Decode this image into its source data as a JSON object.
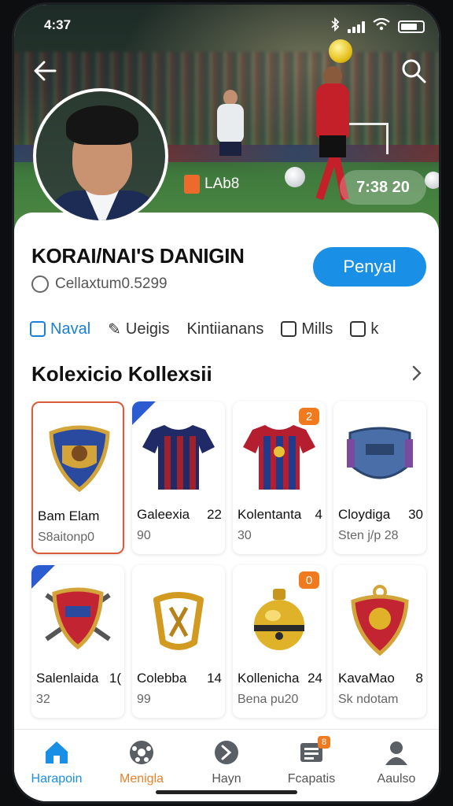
{
  "status_bar": {
    "time": "4:37"
  },
  "header": {
    "chip_left": "LAb8",
    "chip_right": "7:38 20"
  },
  "profile": {
    "name": "KORAI/NAI'S DANIGIN",
    "subtitle": "Cellaxtum0.5299",
    "follow_label": "Penyal"
  },
  "tabs": [
    {
      "label": "Naval",
      "active": true
    },
    {
      "label": "Ueigis"
    },
    {
      "label": "Kintiianans"
    },
    {
      "label": "Mills"
    },
    {
      "label": "k"
    }
  ],
  "collection": {
    "title": "Kolexicio Kollexsii",
    "items": [
      {
        "title": "Bam Elam",
        "count": "",
        "meta": "S8aitonp0",
        "art": "shield-icon",
        "selected": true
      },
      {
        "title": "Galeexia",
        "count": "22",
        "meta": "90",
        "art": "jersey-icon",
        "ribbon": "purple"
      },
      {
        "title": "Kolentanta",
        "count": "4",
        "meta": "30",
        "art": "jersey-icon",
        "badge": "2"
      },
      {
        "title": "Cloydiga",
        "count": "30",
        "meta": "Sten j/p 28",
        "art": "banner-icon"
      },
      {
        "title": "Salenlaida",
        "count": "1(",
        "meta": "32",
        "art": "shield-icon",
        "ribbon": "orange"
      },
      {
        "title": "Colebba",
        "count": "14",
        "meta": "99",
        "art": "emblem-icon"
      },
      {
        "title": "Kollenicha",
        "count": "24",
        "meta": "Bena pu20",
        "art": "trophy-icon",
        "badge": "0"
      },
      {
        "title": "KavaMao",
        "count": "8",
        "meta": "Sk ndotam",
        "art": "crest-icon"
      }
    ]
  },
  "nav": [
    {
      "label": "Harapoin",
      "icon": "home-icon",
      "active": true
    },
    {
      "label": "Menigla",
      "icon": "ball-icon",
      "warm": true
    },
    {
      "label": "Hayn",
      "icon": "play-icon"
    },
    {
      "label": "Fcapatis",
      "icon": "list-icon",
      "badge": "8"
    },
    {
      "label": "Aaulso",
      "icon": "profile-icon"
    }
  ],
  "colors": {
    "accent": "#1a8fe6",
    "badge": "#f07a1d",
    "selected_border": "#d95c3d"
  }
}
